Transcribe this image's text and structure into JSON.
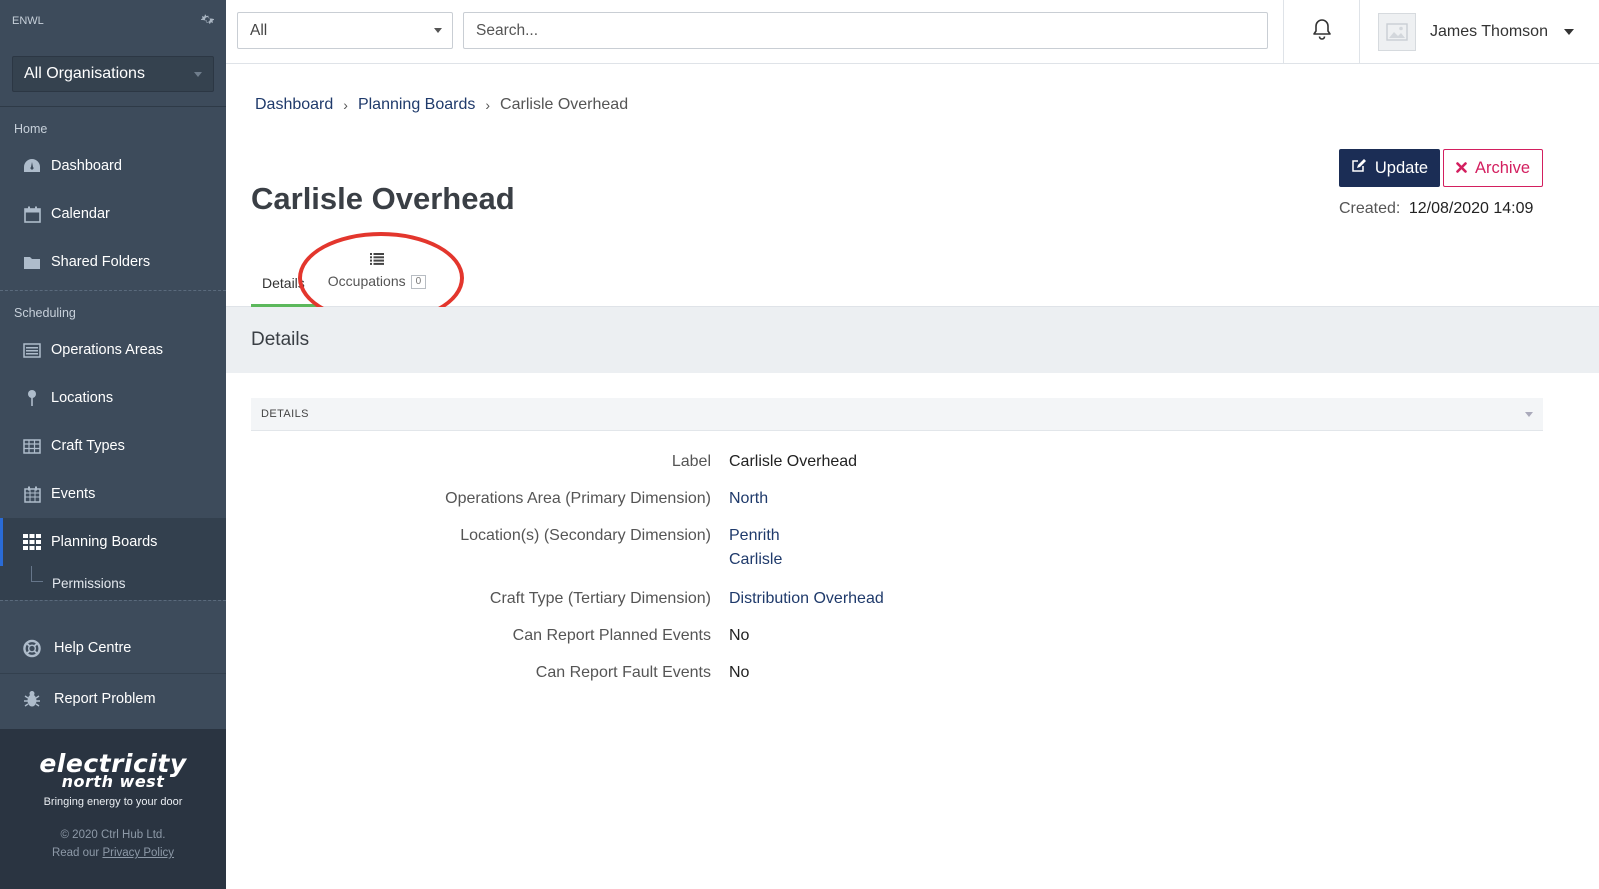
{
  "sidebar": {
    "brand": "ENWL",
    "org_select": "All Organisations",
    "sections": {
      "home": "Home",
      "scheduling": "Scheduling"
    },
    "items": {
      "dashboard": "Dashboard",
      "calendar": "Calendar",
      "shared_folders": "Shared Folders",
      "operations_areas": "Operations Areas",
      "locations": "Locations",
      "craft_types": "Craft Types",
      "events": "Events",
      "planning_boards": "Planning Boards",
      "permissions": "Permissions",
      "help_centre": "Help Centre",
      "report_problem": "Report Problem"
    },
    "footer": {
      "logo_line1": "electricity",
      "logo_line2": "north west",
      "tagline": "Bringing energy to your door",
      "copyright": "© 2020 Ctrl Hub Ltd.",
      "privacy_prefix": "Read our",
      "privacy_link": "Privacy Policy"
    }
  },
  "topbar": {
    "scope_value": "All",
    "search_placeholder": "Search...",
    "user_name": "James Thomson"
  },
  "breadcrumb": {
    "items": [
      "Dashboard",
      "Planning Boards"
    ],
    "current": "Carlisle Overhead"
  },
  "page": {
    "title": "Carlisle Overhead",
    "update_label": "Update",
    "archive_label": "Archive",
    "created_label": "Created:",
    "created_value": "12/08/2020 14:09"
  },
  "tabs": {
    "details": "Details",
    "occupations": "Occupations",
    "occupations_count": "0"
  },
  "panel": {
    "heading": "Details",
    "section_title": "DETAILS"
  },
  "details": {
    "label_key": "Label",
    "label_val": "Carlisle Overhead",
    "ops_key": "Operations Area (Primary Dimension)",
    "ops_val": "North",
    "loc_key": "Location(s) (Secondary Dimension)",
    "loc_val_1": "Penrith",
    "loc_val_2": "Carlisle",
    "craft_key": "Craft Type (Tertiary Dimension)",
    "craft_val": "Distribution Overhead",
    "planned_key": "Can Report Planned Events",
    "planned_val": "No",
    "fault_key": "Can Report Fault Events",
    "fault_val": "No"
  },
  "colors": {
    "sidebar_bg": "#3d4b5b",
    "primary": "#1b2d55",
    "danger": "#d31f5f",
    "link": "#1f3a6b",
    "tab_active": "#5cb85c",
    "annotation": "#e3362d"
  }
}
